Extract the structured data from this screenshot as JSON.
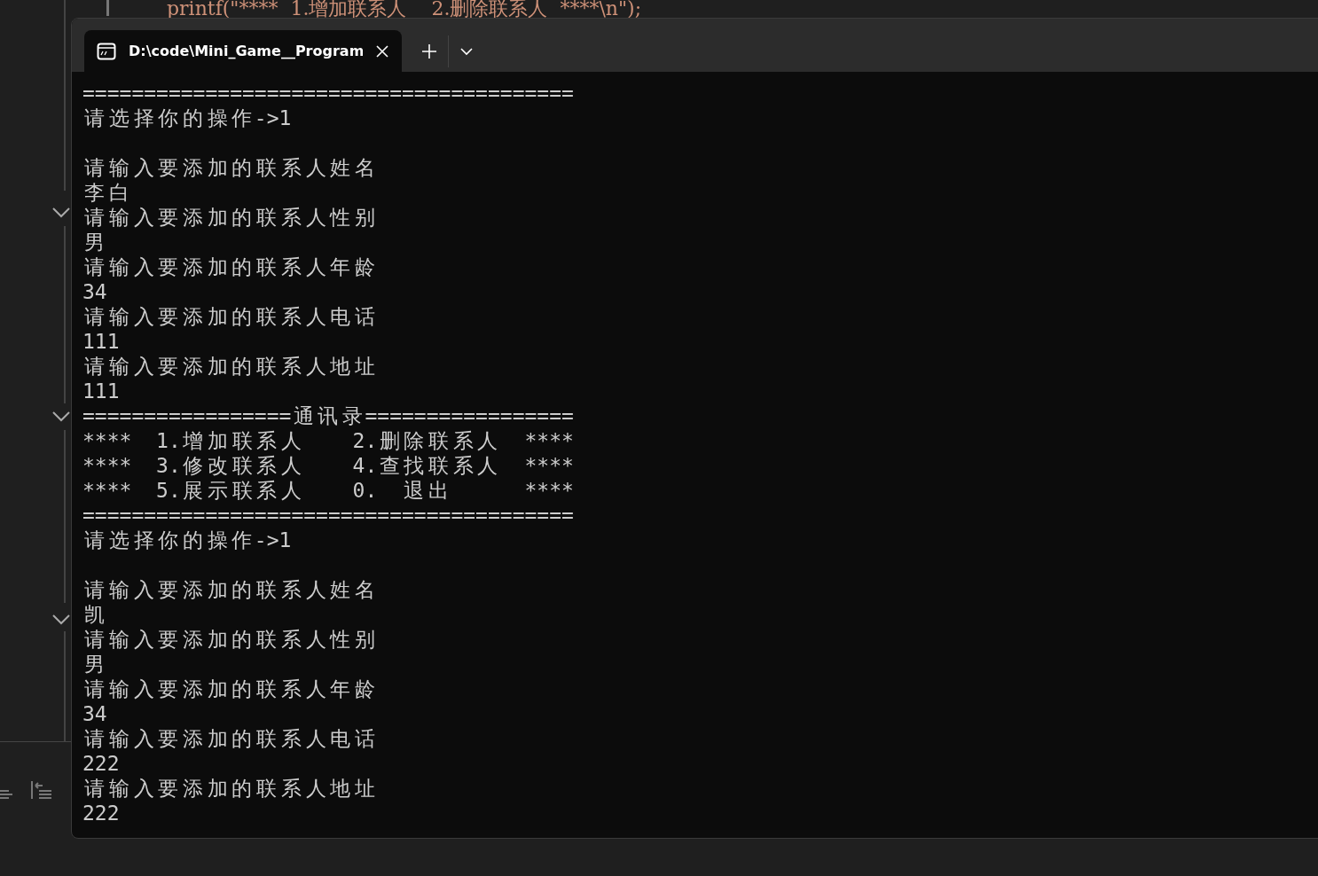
{
  "editor": {
    "code_line": "printf(\"****  1.增加联系人    2.删除联系人  ****\\n\");"
  },
  "terminal": {
    "tabs": [
      {
        "title": "D:\\code\\Mini_Game__Program",
        "selected": true
      }
    ],
    "lines": [
      {
        "kind": "text",
        "text": "========================================"
      },
      {
        "kind": "text",
        "text": "请选择你的操作->1"
      },
      {
        "kind": "blank"
      },
      {
        "kind": "text",
        "text": "请输入要添加的联系人姓名"
      },
      {
        "kind": "text",
        "text": "李白"
      },
      {
        "kind": "text",
        "text": "请输入要添加的联系人性别"
      },
      {
        "kind": "text",
        "text": "男"
      },
      {
        "kind": "text",
        "text": "请输入要添加的联系人年龄"
      },
      {
        "kind": "text",
        "text": "34"
      },
      {
        "kind": "text",
        "text": "请输入要添加的联系人电话"
      },
      {
        "kind": "text",
        "text": "111"
      },
      {
        "kind": "text",
        "text": "请输入要添加的联系人地址"
      },
      {
        "kind": "text",
        "text": "111"
      },
      {
        "kind": "text",
        "text": "=================通讯录================="
      },
      {
        "kind": "text",
        "text": "****  1.增加联系人    2.删除联系人  ****"
      },
      {
        "kind": "text",
        "text": "****  3.修改联系人    4.查找联系人  ****"
      },
      {
        "kind": "text",
        "text": "****  5.展示联系人    0.  退出      ****"
      },
      {
        "kind": "text",
        "text": "========================================"
      },
      {
        "kind": "text",
        "text": "请选择你的操作->1"
      },
      {
        "kind": "blank"
      },
      {
        "kind": "text",
        "text": "请输入要添加的联系人姓名"
      },
      {
        "kind": "text",
        "text": "凯"
      },
      {
        "kind": "text",
        "text": "请输入要添加的联系人性别"
      },
      {
        "kind": "text",
        "text": "男"
      },
      {
        "kind": "text",
        "text": "请输入要添加的联系人年龄"
      },
      {
        "kind": "text",
        "text": "34"
      },
      {
        "kind": "text",
        "text": "请输入要添加的联系人电话"
      },
      {
        "kind": "text",
        "text": "222"
      },
      {
        "kind": "text",
        "text": "请输入要添加的联系人地址"
      },
      {
        "kind": "text",
        "text": "222"
      }
    ]
  }
}
